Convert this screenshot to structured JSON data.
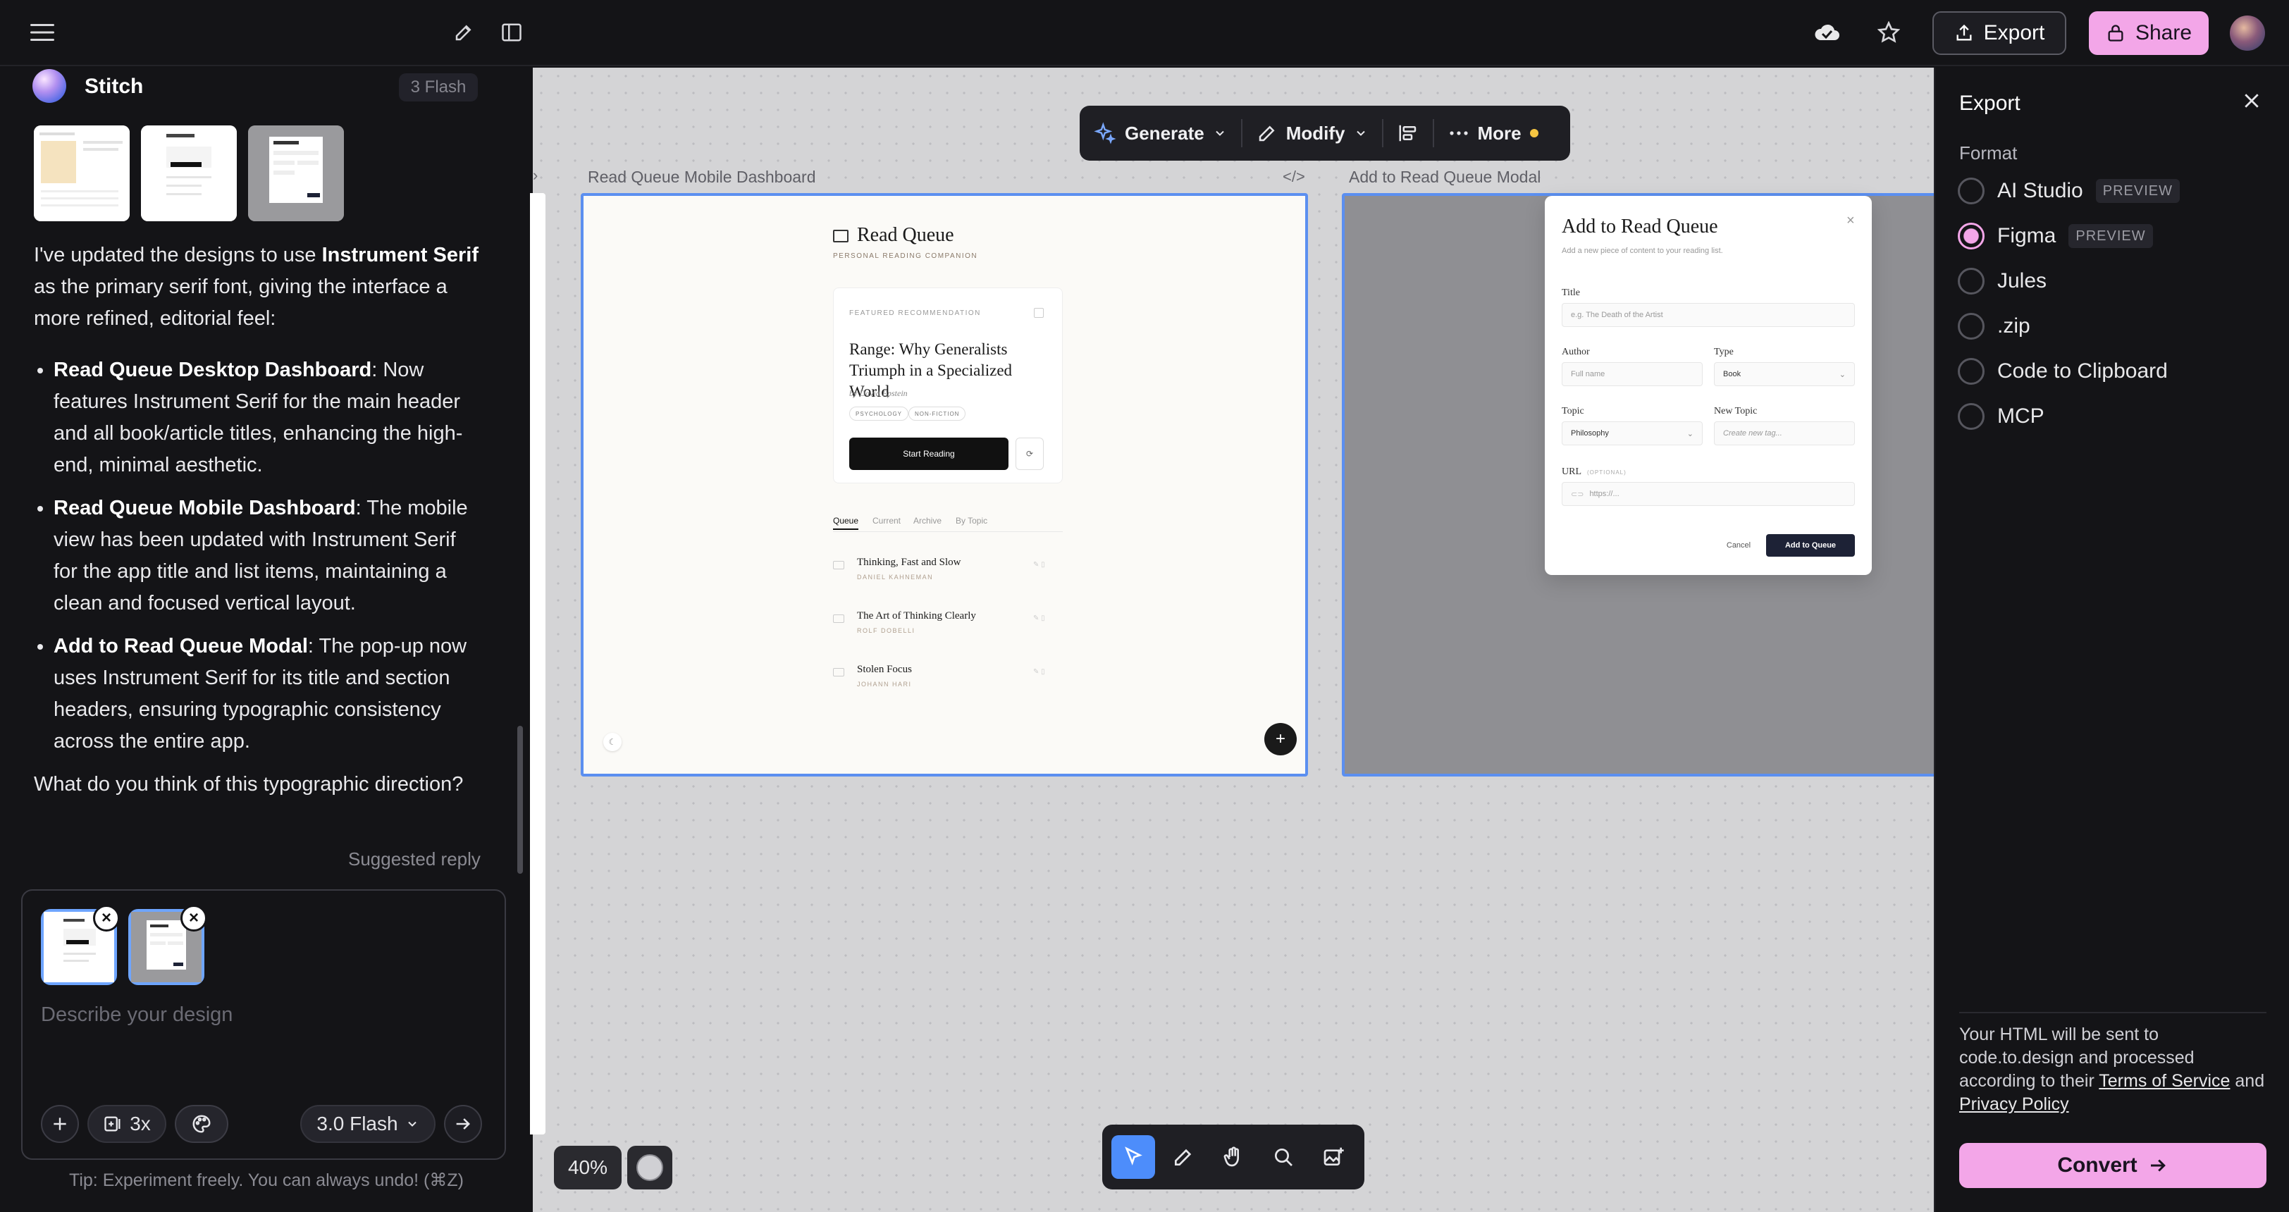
{
  "topbar": {
    "export_label": "Export",
    "share_label": "Share"
  },
  "chat": {
    "agent_name": "Stitch",
    "model_badge": "3 Flash",
    "intro_a": "I've updated the designs to use ",
    "intro_bold": "Instrument Serif",
    "intro_b": " as the primary serif font, giving the interface a more refined, editorial feel:",
    "bullets": [
      {
        "title": "Read Queue Desktop Dashboard",
        "text": ": Now features Instrument Serif for the main header and all book/article titles, enhancing the high-end, minimal aesthetic."
      },
      {
        "title": "Read Queue Mobile Dashboard",
        "text": ": The mobile view has been updated with Instrument Serif for the app title and list items, maintaining a clean and focused vertical layout."
      },
      {
        "title": "Add to Read Queue Modal",
        "text": ": The pop-up now uses Instrument Serif for its title and section headers, ensuring typographic consistency across the entire app."
      }
    ],
    "question": "What do you think of this typographic direction?",
    "suggested_reply": "Suggested reply"
  },
  "composer": {
    "placeholder": "Describe your design",
    "variants_label": "3x",
    "model_label": "3.0 Flash",
    "tip": "Tip: Experiment freely. You can always undo! (⌘Z)"
  },
  "canvas": {
    "toolbar": {
      "generate": "Generate",
      "modify": "Modify",
      "more": "More"
    },
    "mobile_frame_label": "Read Queue Mobile Dashboard",
    "modal_frame_label": "Add to Read Queue Modal",
    "zoom": "40%"
  },
  "mobile_screen": {
    "app_title": "Read Queue",
    "app_subtitle": "PERSONAL READING COMPANION",
    "featured_label": "FEATURED RECOMMENDATION",
    "featured_title": "Range: Why Generalists Triumph in a Specialized World",
    "featured_author": "by David Epstein",
    "tags": [
      "PSYCHOLOGY",
      "NON-FICTION"
    ],
    "start_button": "Start Reading",
    "tabs": [
      "Queue",
      "Current",
      "Archive",
      "By Topic"
    ],
    "books": [
      {
        "title": "Thinking, Fast and Slow",
        "author": "DANIEL KAHNEMAN"
      },
      {
        "title": "The Art of Thinking Clearly",
        "author": "ROLF DOBELLI"
      },
      {
        "title": "Stolen Focus",
        "author": "JOHANN HARI"
      }
    ]
  },
  "modal_screen": {
    "title": "Add to Read Queue",
    "subtitle": "Add a new piece of content to your reading list.",
    "title_label": "Title",
    "title_placeholder": "e.g. The Death of the Artist",
    "author_label": "Author",
    "author_placeholder": "Full name",
    "type_label": "Type",
    "type_value": "Book",
    "topic_label": "Topic",
    "topic_value": "Philosophy",
    "new_topic_label": "New Topic",
    "new_topic_placeholder": "Create new tag...",
    "url_label": "URL",
    "url_optional": "(OPTIONAL)",
    "url_placeholder": "https://...",
    "cancel": "Cancel",
    "submit": "Add to Queue"
  },
  "export_panel": {
    "title": "Export",
    "format_label": "Format",
    "options": [
      {
        "label": "AI Studio",
        "badge": "PREVIEW"
      },
      {
        "label": "Figma",
        "badge": "PREVIEW"
      },
      {
        "label": "Jules",
        "badge": ""
      },
      {
        "label": ".zip",
        "badge": ""
      },
      {
        "label": "Code to Clipboard",
        "badge": ""
      },
      {
        "label": "MCP",
        "badge": ""
      }
    ],
    "selected_index": 1,
    "legal_a": "Your HTML will be sent to code.to.design and processed according to their ",
    "terms_link": "Terms of Service",
    "legal_b": " and ",
    "privacy_link": "Privacy Policy",
    "convert_label": "Convert"
  },
  "colors": {
    "accent_pink": "#f3a6e8",
    "selection_blue": "#5b8ff0",
    "active_tool": "#4d8dfb"
  }
}
